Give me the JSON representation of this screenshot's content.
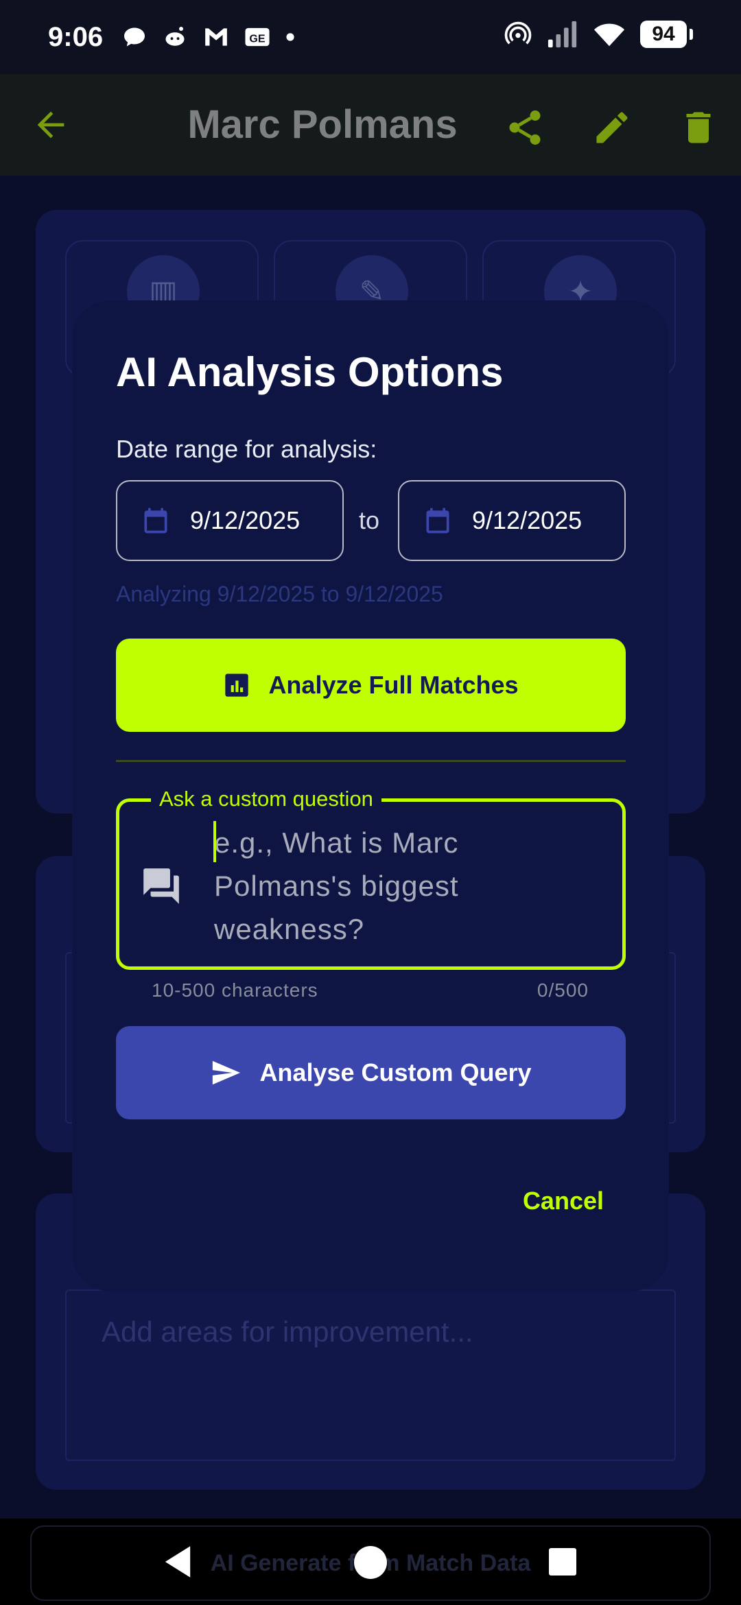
{
  "status_bar": {
    "time": "9:06",
    "battery": "94",
    "left_icons": [
      "chat-bubble-icon",
      "reddit-icon",
      "gmail-icon",
      "ge-icon",
      "dot-icon"
    ],
    "right_icons": [
      "hotspot-icon",
      "signal-icon",
      "wifi-icon",
      "battery-icon"
    ]
  },
  "app_bar": {
    "title": "Marc Polmans",
    "actions": [
      "share-icon",
      "edit-icon",
      "delete-icon"
    ],
    "accent": "#7b9d10"
  },
  "background": {
    "tiles": [
      "chart-icon",
      "clipboard-edit-icon",
      "sparkle-icon"
    ],
    "improvement_placeholder": "Add areas for improvement...",
    "bottom_button": "AI Generate from Match Data"
  },
  "dialog": {
    "title": "AI Analysis Options",
    "date_label": "Date range for analysis:",
    "date_from": "9/12/2025",
    "date_to": "9/12/2025",
    "to_label": "to",
    "range_note": "Analyzing 9/12/2025 to 9/12/2025",
    "analyze_button": "Analyze Full Matches",
    "question_label": "Ask a custom question",
    "question_placeholder": "e.g., What is Marc Polmans's biggest weakness?",
    "question_value": "",
    "helper_text": "10-500 characters",
    "char_counter": "0/500",
    "custom_button": "Analyse Custom Query",
    "cancel_button": "Cancel"
  },
  "colors": {
    "accent_lime": "#c0ff02",
    "button_indigo": "#3c47ad",
    "dialog_bg": "#0e1543"
  }
}
